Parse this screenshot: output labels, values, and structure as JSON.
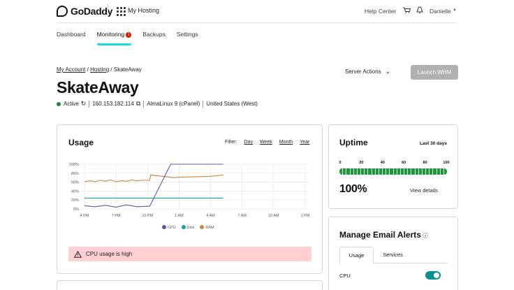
{
  "header": {
    "brand": "GoDaddy",
    "product": "My Hosting",
    "help_center": "Help Center",
    "user_name": "Danielle",
    "icons": [
      "apps-grid-icon",
      "cart-icon",
      "bell-icon",
      "chevron-down-icon"
    ]
  },
  "tabs": [
    {
      "label": "Dashboard"
    },
    {
      "label": "Monitoring",
      "badge": "1"
    },
    {
      "label": "Backups"
    },
    {
      "label": "Settings"
    }
  ],
  "breadcrumb": {
    "items": [
      "My Account",
      "Hosting",
      "SkateAway"
    ],
    "separator": "/"
  },
  "server_actions_label": "Server Actions",
  "launch_button": "Launch WHM",
  "server": {
    "name": "SkateAway",
    "status": "Active",
    "ip": "160.153.182.114",
    "os": "AlmaLinux 9 (cPanel)",
    "region": "United States (West)"
  },
  "usage": {
    "title": "Usage",
    "filter_label": "Filter:",
    "filters": [
      "Day",
      "Week",
      "Month",
      "Year"
    ],
    "alert": "CPU usage is high"
  },
  "chart_data": {
    "type": "line",
    "x_ticks": [
      "4 PM",
      "7 PM",
      "10 PM",
      "1 AM",
      "4 AM",
      "7 AM",
      "10 AM",
      "1 PM"
    ],
    "y_ticks": [
      "0%",
      "20%",
      "40%",
      "60%",
      "80%",
      "100%"
    ],
    "ylim": [
      0,
      100
    ],
    "x_hours": [
      0,
      3,
      6,
      9,
      12,
      15,
      18,
      21
    ],
    "series": [
      {
        "name": "CPU",
        "color": "#6b4fa8",
        "x": [
          0,
          1,
          2,
          3,
          4,
          5,
          6,
          6.2,
          8.2,
          9,
          12,
          13.2
        ],
        "y": [
          7,
          5,
          8,
          4,
          9,
          5,
          6,
          6,
          100,
          100,
          100,
          100
        ]
      },
      {
        "name": "Disk",
        "color": "#1a9e9e",
        "x": [
          0,
          3,
          6,
          9,
          12,
          13.2
        ],
        "y": [
          24,
          24,
          24,
          24,
          24,
          24
        ]
      },
      {
        "name": "RAM",
        "color": "#d4843b",
        "x": [
          0,
          0.5,
          1,
          1.5,
          2,
          2.5,
          3,
          3.5,
          4,
          4.5,
          5,
          5.5,
          6,
          6.2,
          6.3,
          8.5,
          9,
          12,
          13.2
        ],
        "y": [
          61,
          63,
          61,
          64,
          62,
          65,
          61,
          63,
          62,
          65,
          63,
          64,
          64,
          64,
          76,
          70,
          71,
          73,
          76
        ]
      }
    ]
  },
  "uptime": {
    "title": "Uptime",
    "range": "Last 30 days",
    "ticks": [
      "0",
      "20",
      "40",
      "60",
      "80",
      "100"
    ],
    "value": "100%",
    "details": "View details",
    "bar_color": "#1c9b3c",
    "segments": 30
  },
  "email_alerts": {
    "title": "Manage Email Alerts",
    "tabs": [
      "Usage",
      "Services"
    ],
    "row_label": "CPU",
    "cpu_enabled": true,
    "toggle_color": "#0c8f8f"
  }
}
